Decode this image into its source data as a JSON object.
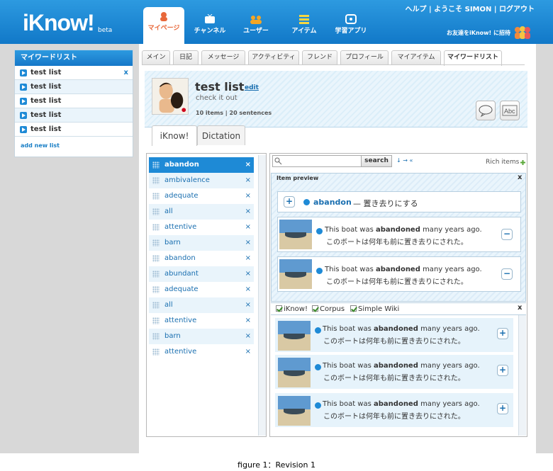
{
  "header": {
    "logo": "iKnow!",
    "logo_sub": "beta",
    "util": "ヘルプ | ようこそ SIMON | ログアウト",
    "invite": "お友達をiKnow! に招待",
    "nav": [
      {
        "label": "マイページ",
        "active": true,
        "icon": "user-icon"
      },
      {
        "label": "チャンネル",
        "active": false,
        "icon": "tv-icon"
      },
      {
        "label": "ユーザー",
        "active": false,
        "icon": "users-icon"
      },
      {
        "label": "アイテム",
        "active": false,
        "icon": "list-icon"
      },
      {
        "label": "学習アプリ",
        "active": false,
        "icon": "app-icon"
      }
    ]
  },
  "sidebar": {
    "title": "マイワードリスト",
    "items": [
      {
        "label": "test list",
        "close": "x"
      },
      {
        "label": "test list"
      },
      {
        "label": "test list"
      },
      {
        "label": "test list"
      },
      {
        "label": "test list"
      }
    ],
    "add_link": "add new list"
  },
  "tabs": [
    "メイン",
    "日記",
    "メッセージ",
    "アクティビティ",
    "フレンド",
    "プロフィール",
    "マイアイテム",
    "マイワードリスト"
  ],
  "list": {
    "title": "test list",
    "edit": "edit",
    "description": "check it out",
    "counts": "10 items | 20 sentences"
  },
  "mode_tabs": [
    "iKnow!",
    "Dictation"
  ],
  "words": [
    {
      "label": "abandon",
      "close": "×"
    },
    {
      "label": "ambivalence",
      "close": "×"
    },
    {
      "label": "adequate",
      "close": "×"
    },
    {
      "label": "all",
      "close": "×"
    },
    {
      "label": "attentive",
      "close": "×"
    },
    {
      "label": "barn",
      "close": "×"
    },
    {
      "label": "abandon",
      "close": "×"
    },
    {
      "label": "abundant",
      "close": "×"
    },
    {
      "label": "adequate",
      "close": "×"
    },
    {
      "label": "all",
      "close": "×"
    },
    {
      "label": "attentive",
      "close": "×"
    },
    {
      "label": "barn",
      "close": "×"
    },
    {
      "label": "attentive",
      "close": "×"
    }
  ],
  "search": {
    "placeholder": "",
    "button": "search",
    "sort": "↓ → «",
    "rich_items": "Rich items"
  },
  "preview": {
    "title": "Item preview",
    "close": "x",
    "word": "abandon",
    "dash": "—",
    "meaning": "置き去りにする",
    "sentences": [
      {
        "en_pre": "This boat was ",
        "en_bold": "abandoned",
        "en_post": " many years ago.",
        "ja": "このボートは何年も前に置き去りにされた。"
      },
      {
        "en_pre": "This boat was ",
        "en_bold": "abandoned",
        "en_post": " many years ago.",
        "ja": "このボートは何年も前に置き去りにされた。"
      }
    ]
  },
  "corpus": {
    "options": [
      "iKnow!",
      "Corpus",
      "Simple Wiki"
    ],
    "close": "x",
    "sentences": [
      {
        "en_pre": "This boat was ",
        "en_bold": "abandoned",
        "en_post": " many years ago.",
        "ja": "このボートは何年も前に置き去りにされた。"
      },
      {
        "en_pre": "This boat was ",
        "en_bold": "abandoned",
        "en_post": " many years ago.",
        "ja": "このボートは何年も前に置き去りにされた。"
      },
      {
        "en_pre": "This boat was ",
        "en_bold": "abandoned",
        "en_post": " many years ago.",
        "ja": "このボートは何年も前に置き去りにされた。"
      }
    ]
  },
  "caption": "figure 1：Revision 1",
  "colors": {
    "accent": "#1e8ad6",
    "brand_orange": "#e8683a",
    "header": "#1a82cf"
  }
}
